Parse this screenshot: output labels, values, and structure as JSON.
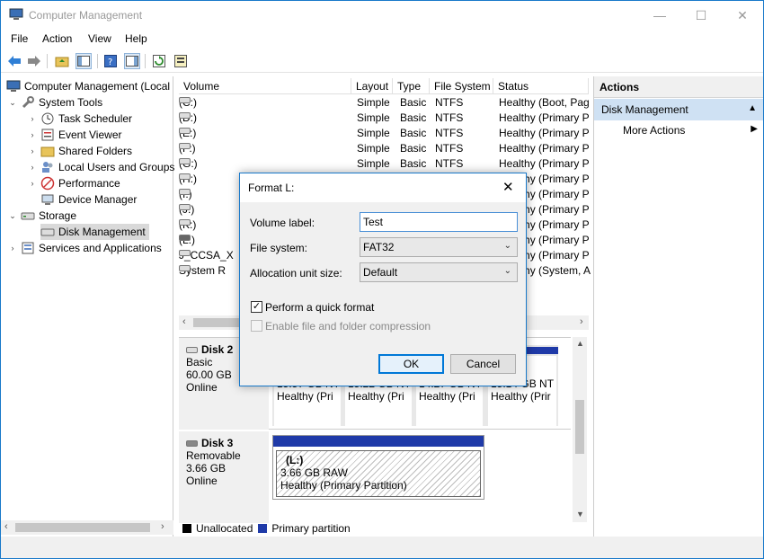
{
  "window": {
    "title": "Computer Management"
  },
  "menu": [
    "File",
    "Action",
    "View",
    "Help"
  ],
  "tree": {
    "root": "Computer Management (Local",
    "system_tools": "System Tools",
    "task_scheduler": "Task Scheduler",
    "event_viewer": "Event Viewer",
    "shared_folders": "Shared Folders",
    "local_users": "Local Users and Groups",
    "performance": "Performance",
    "device_manager": "Device Manager",
    "storage": "Storage",
    "disk_management": "Disk Management",
    "services": "Services and Applications"
  },
  "volume_table": {
    "headers": [
      "Volume",
      "Layout",
      "Type",
      "File System",
      "Status"
    ],
    "rows": [
      {
        "volume": "(C:)",
        "layout": "Simple",
        "type": "Basic",
        "fs": "NTFS",
        "status": "Healthy (Boot, Pag"
      },
      {
        "volume": "(D:)",
        "layout": "Simple",
        "type": "Basic",
        "fs": "NTFS",
        "status": "Healthy (Primary P"
      },
      {
        "volume": "(E:)",
        "layout": "Simple",
        "type": "Basic",
        "fs": "NTFS",
        "status": "Healthy (Primary P"
      },
      {
        "volume": "(F:)",
        "layout": "Simple",
        "type": "Basic",
        "fs": "NTFS",
        "status": "Healthy (Primary P"
      },
      {
        "volume": "(G:)",
        "layout": "Simple",
        "type": "Basic",
        "fs": "NTFS",
        "status": "Healthy (Primary P"
      },
      {
        "volume": "(H:)",
        "layout": "",
        "type": "",
        "fs": "",
        "status": "Healthy (Primary P"
      },
      {
        "volume": "(I:)",
        "layout": "",
        "type": "",
        "fs": "",
        "status": "Healthy (Primary P"
      },
      {
        "volume": "(J:)",
        "layout": "",
        "type": "",
        "fs": "",
        "status": "Healthy (Primary P"
      },
      {
        "volume": "(K:)",
        "layout": "",
        "type": "",
        "fs": "",
        "status": "Healthy (Primary P"
      },
      {
        "volume": "(L:)",
        "layout": "",
        "type": "",
        "fs": "",
        "status": "Healthy (Primary P"
      },
      {
        "volume": "J_CCSA_X",
        "layout": "",
        "type": "",
        "fs": "",
        "status": "Healthy (Primary P"
      },
      {
        "volume": "System R",
        "layout": "",
        "type": "",
        "fs": "",
        "status": "Healthy (System, A"
      }
    ]
  },
  "disk2": {
    "name": "Disk 2",
    "kind": "Basic",
    "size": "60.00 GB",
    "state": "Online",
    "partitions": [
      {
        "size": "15.57 GB NT",
        "status": "Healthy (Pri"
      },
      {
        "size": "15.22 GB NT",
        "status": "Healthy (Pri"
      },
      {
        "size": "14.27 GB NT",
        "status": "Healthy (Pri"
      },
      {
        "size": "15.14 GB NT",
        "status": "Healthy (Prir"
      }
    ]
  },
  "disk3": {
    "name": "Disk 3",
    "kind": "Removable",
    "size": "3.66 GB",
    "state": "Online",
    "partition": {
      "label": "(L:)",
      "size": "3.66 GB RAW",
      "status": "Healthy (Primary Partition)"
    }
  },
  "legend": {
    "unallocated": "Unallocated",
    "primary": "Primary partition"
  },
  "actions": {
    "header": "Actions",
    "section": "Disk Management",
    "more": "More Actions"
  },
  "dialog": {
    "title": "Format L:",
    "volume_label": "Volume label:",
    "volume_value": "Test",
    "file_system": "File system:",
    "file_system_value": "FAT32",
    "alloc": "Allocation unit size:",
    "alloc_value": "Default",
    "quick": "Perform a quick format",
    "compress": "Enable file and folder compression",
    "ok": "OK",
    "cancel": "Cancel"
  }
}
